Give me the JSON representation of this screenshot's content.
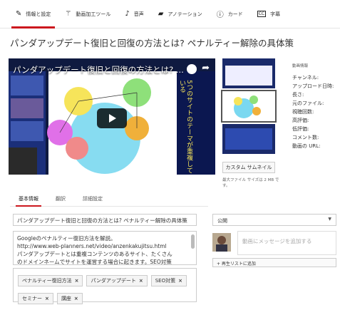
{
  "nav": {
    "tabs": [
      {
        "label": "情報と設定",
        "icon": "pencil-icon"
      },
      {
        "label": "動画加工ツール",
        "icon": "magic-wand-icon"
      },
      {
        "label": "音声",
        "icon": "music-note-icon"
      },
      {
        "label": "アノテーション",
        "icon": "speech-bubble-icon"
      },
      {
        "label": "カード",
        "icon": "info-icon"
      },
      {
        "label": "字幕",
        "icon": "cc-icon"
      }
    ]
  },
  "page_title": "パンダアップデート復旧と回復の方法とは? ペナルティー解除の具体策",
  "player": {
    "overlay_title": "パンダアップデート復旧と回復の方法とは? ...",
    "vertical_text": "5つのサイトのテーマが重複している"
  },
  "thumbnail": {
    "custom_button": "カスタム サムネイル",
    "max_size_note": "最大ファイル サイズは 2 MB です。"
  },
  "video_info": {
    "header": "動画情報",
    "labels": [
      "チャンネル:",
      "アップロード日時:",
      "長さ:",
      "元のファイル:",
      "視聴回数:",
      "高評価:",
      "低評価:",
      "コメント数:",
      "動画の URL:"
    ]
  },
  "subtabs": [
    "基本情報",
    "翻訳",
    "詳細設定"
  ],
  "form": {
    "title_value": "パンダアップデート復旧と回復の方法とは? ペナルティー解除の具体策",
    "description_lines": [
      "Googleのペナルティー復旧方法を解説。",
      "http://www.web-planners.net/video/anzenkakujitsu.html",
      "パンダアップデートとは重複コンテンツのあるサイト、たくさん",
      "のドメインネームでサイトを運営する場合に起きます。SEO対策"
    ],
    "tags": [
      "ペナルティー復旧方法",
      "パンダアップデート",
      "SEO対策",
      "セミナー",
      "講座"
    ],
    "tag_remove": "×"
  },
  "privacy": {
    "selected": "公開",
    "caret": "▼"
  },
  "comment": {
    "placeholder": "動画にメッセージを追加する"
  },
  "playlist": {
    "button": "+ 再生リストに追加"
  },
  "colors": {
    "accent": "#cc181e",
    "player_bg": "#0f1a40"
  }
}
